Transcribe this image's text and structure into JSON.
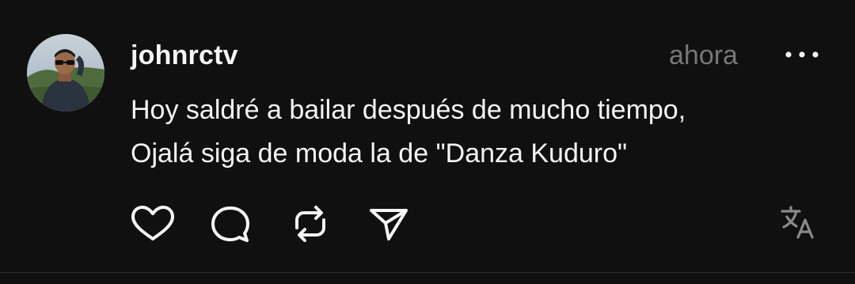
{
  "post": {
    "username": "johnrctv",
    "timestamp": "ahora",
    "text_lines": [
      "Hoy saldré a bailar después de mucho tiempo,",
      "Ojalá siga de moda la de \"Danza Kuduro\""
    ],
    "avatar": {
      "icon": "profile-photo",
      "description_color": "#4a5a3e"
    },
    "more_icon": "more-horizontal-icon",
    "actions": [
      {
        "icon": "heart-icon"
      },
      {
        "icon": "comment-icon"
      },
      {
        "icon": "repost-icon"
      },
      {
        "icon": "share-icon"
      }
    ],
    "translate_icon": "translate-icon"
  },
  "colors": {
    "background": "#101010",
    "primary_text": "#f3f5f7",
    "secondary_text": "#777777",
    "icon": "#f3f5f7",
    "muted_icon": "#8a8a8a"
  }
}
